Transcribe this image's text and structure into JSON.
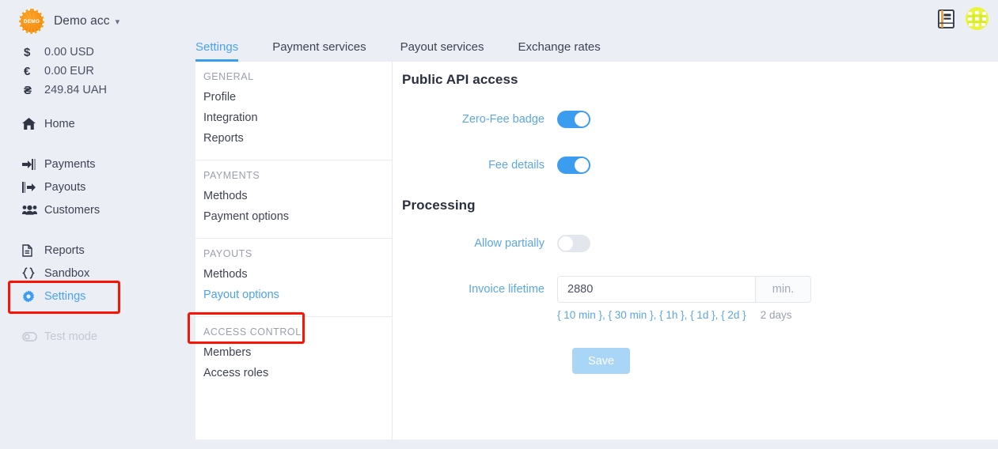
{
  "account": {
    "badge_text": "DEMO",
    "name": "Demo acc",
    "chevron": "⌄"
  },
  "balances": [
    {
      "symbol": "$",
      "amount": "0.00 USD"
    },
    {
      "symbol": "€",
      "amount": "0.00 EUR"
    },
    {
      "symbol": "₴",
      "amount": "249.84 UAH"
    }
  ],
  "sidebar": {
    "group1": [
      {
        "label": "Home",
        "icon": "home-icon",
        "state": "normal"
      }
    ],
    "group2": [
      {
        "label": "Payments",
        "icon": "sign-in-icon",
        "state": "normal"
      },
      {
        "label": "Payouts",
        "icon": "sign-out-icon",
        "state": "normal"
      },
      {
        "label": "Customers",
        "icon": "users-icon",
        "state": "normal"
      }
    ],
    "group3": [
      {
        "label": "Reports",
        "icon": "document-icon",
        "state": "normal"
      },
      {
        "label": "Sandbox",
        "icon": "braces-icon",
        "state": "normal"
      },
      {
        "label": "Settings",
        "icon": "gear-icon",
        "state": "active"
      }
    ],
    "group4": [
      {
        "label": "Test mode",
        "icon": "toggle-icon",
        "state": "disabled"
      }
    ]
  },
  "header": {
    "tabs": [
      {
        "label": "Settings",
        "active": true
      },
      {
        "label": "Payment services",
        "active": false
      },
      {
        "label": "Payout services",
        "active": false
      },
      {
        "label": "Exchange rates",
        "active": false
      }
    ],
    "icons": [
      {
        "name": "book-icon"
      },
      {
        "name": "avatar-identicon"
      }
    ]
  },
  "submenu": {
    "sections": [
      {
        "heading": "GENERAL",
        "items": [
          {
            "label": "Profile",
            "active": false
          },
          {
            "label": "Integration",
            "active": false
          },
          {
            "label": "Reports",
            "active": false
          }
        ]
      },
      {
        "heading": "PAYMENTS",
        "items": [
          {
            "label": "Methods",
            "active": false
          },
          {
            "label": "Payment options",
            "active": false
          }
        ]
      },
      {
        "heading": "PAYOUTS",
        "items": [
          {
            "label": "Methods",
            "active": false
          },
          {
            "label": "Payout options",
            "active": true
          }
        ]
      },
      {
        "heading": "ACCESS CONTROL",
        "items": [
          {
            "label": "Members",
            "active": false
          },
          {
            "label": "Access roles",
            "active": false
          }
        ]
      }
    ]
  },
  "main": {
    "public_api": {
      "title": "Public API access",
      "zero_fee_badge": {
        "label": "Zero-Fee badge",
        "value": "on"
      },
      "fee_details": {
        "label": "Fee details",
        "value": "on"
      }
    },
    "processing": {
      "title": "Processing",
      "allow_partially": {
        "label": "Allow partially",
        "value": "off"
      },
      "invoice_lifetime": {
        "label": "Invoice lifetime",
        "value": "2880",
        "placeholder": "",
        "unit": "min.",
        "presets": "{ 10 min }, { 30 min }, { 1h }, { 1d }, { 2d }",
        "resolved": "2 days"
      },
      "save_label": "Save"
    }
  },
  "annotations": {
    "highlight_color": "#fb1406",
    "boxes": [
      "settings-sidebar-item",
      "payout-options-submenu-item"
    ]
  }
}
